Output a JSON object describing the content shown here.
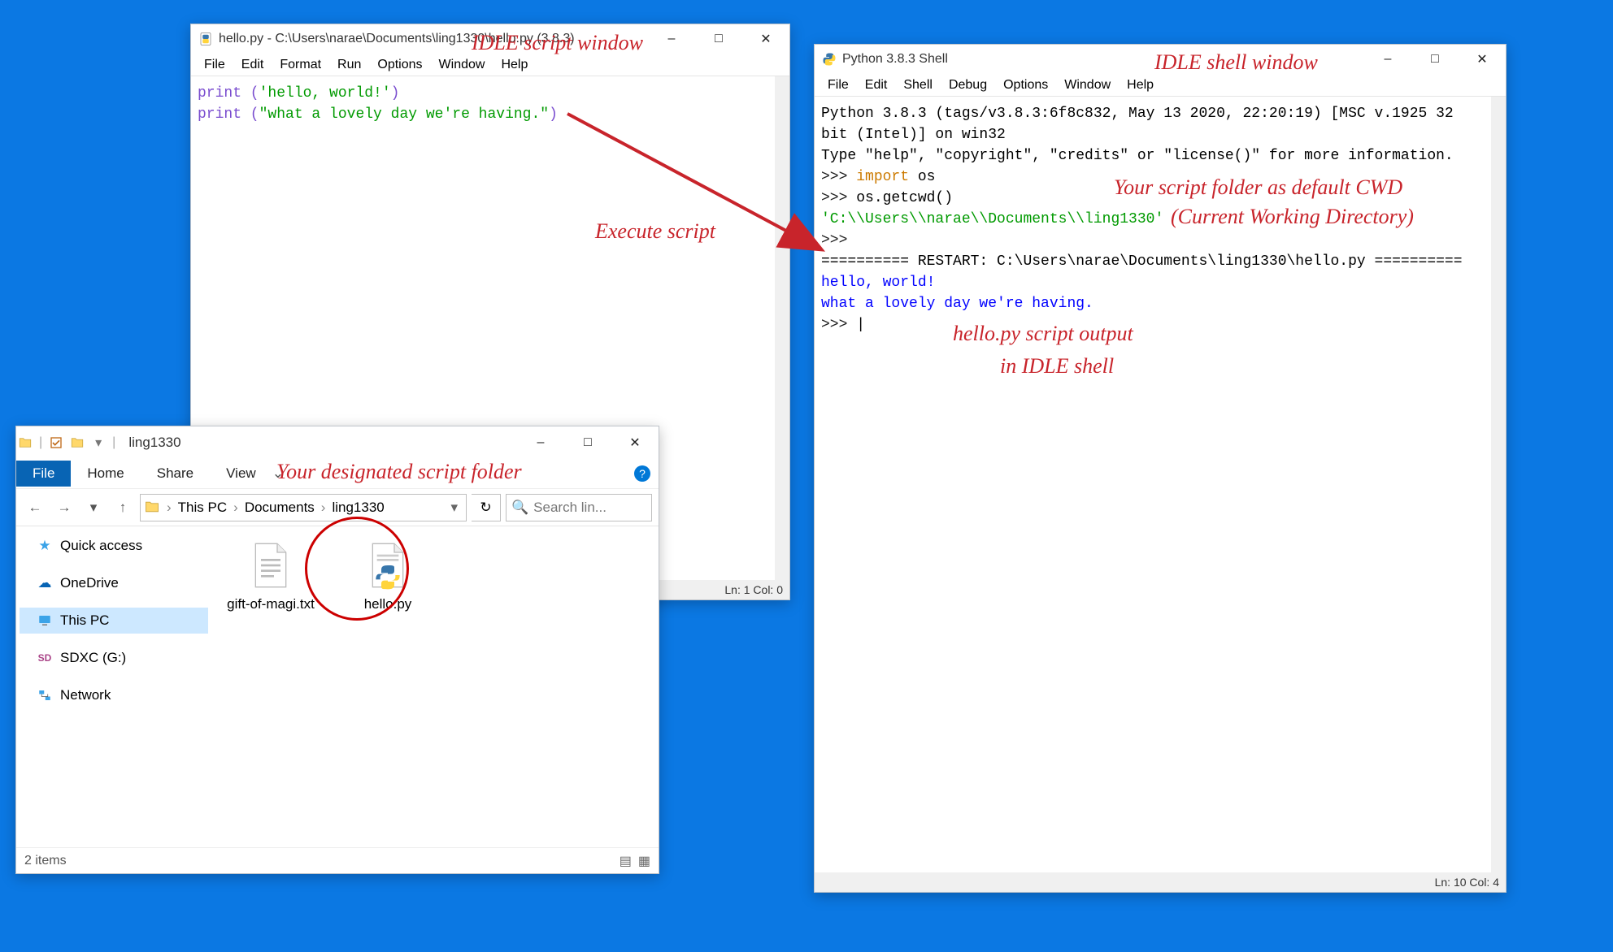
{
  "script_window": {
    "title": "hello.py - C:\\Users\\narae\\Documents\\ling1330\\hello.py (3.8.3)",
    "menus": [
      "File",
      "Edit",
      "Format",
      "Run",
      "Options",
      "Window",
      "Help"
    ],
    "code": {
      "line1_pre": "print (",
      "line1_str": "'hello, world!'",
      "line1_post": ")",
      "line2_pre": "print (",
      "line2_str": "\"what a lovely day we're having.\"",
      "line2_post": ")"
    },
    "status": "Ln: 1  Col: 0"
  },
  "shell_window": {
    "title": "Python 3.8.3 Shell",
    "menus": [
      "File",
      "Edit",
      "Shell",
      "Debug",
      "Options",
      "Window",
      "Help"
    ],
    "banner1": "Python 3.8.3 (tags/v3.8.3:6f8c832, May 13 2020, 22:20:19) [MSC v.1925 32 bit (Intel)] on win32",
    "banner2": "Type \"help\", \"copyright\", \"credits\" or \"license()\" for more information.",
    "prompt": ">>> ",
    "import_kw": "import",
    "import_mod": " os",
    "getcwd": "os.getcwd()",
    "cwd_out": "'C:\\\\Users\\\\narae\\\\Documents\\\\ling1330'",
    "restart": "========== RESTART: C:\\Users\\narae\\Documents\\ling1330\\hello.py ==========",
    "out1": "hello, world!",
    "out2": "what a lovely day we're having.",
    "status": "Ln: 10  Col: 4"
  },
  "explorer": {
    "title": "ling1330",
    "ribbon": {
      "file": "File",
      "tabs": [
        "Home",
        "Share",
        "View"
      ]
    },
    "crumbs": [
      "This PC",
      "Documents",
      "ling1330"
    ],
    "search_placeholder": "Search lin...",
    "nav_items": [
      {
        "label": "Quick access",
        "icon": "star"
      },
      {
        "label": "OneDrive",
        "icon": "cloud"
      },
      {
        "label": "This PC",
        "icon": "pc",
        "selected": true
      },
      {
        "label": "SDXC (G:)",
        "icon": "sd"
      },
      {
        "label": "Network",
        "icon": "net"
      }
    ],
    "files": [
      {
        "name": "gift-of-magi.txt",
        "icon": "txt"
      },
      {
        "name": "hello.py",
        "icon": "py"
      }
    ],
    "status": "2 items"
  },
  "annotations": {
    "script_label": "IDLE script window",
    "shell_label": "IDLE shell window",
    "exec": "Execute script",
    "cwd1": "Your script folder as default CWD",
    "cwd2": "(Current Working Directory)",
    "out1": "hello.py script output",
    "out2": "in IDLE shell",
    "folder": "Your designated script folder"
  }
}
